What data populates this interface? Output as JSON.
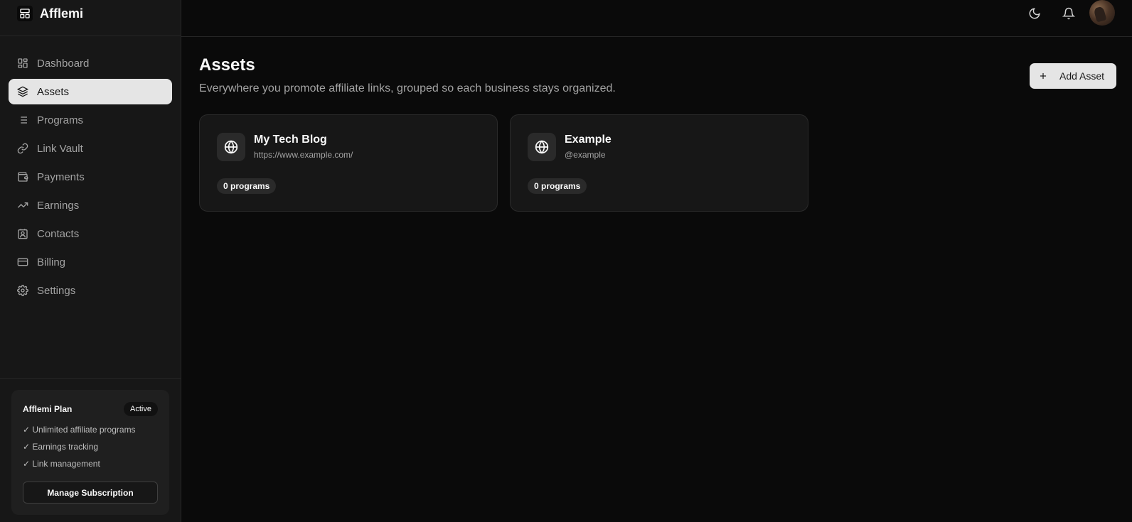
{
  "app": {
    "name": "Afflemi"
  },
  "sidebar": {
    "items": [
      {
        "label": "Dashboard",
        "icon": "dashboard-icon"
      },
      {
        "label": "Assets",
        "icon": "layers-icon",
        "active": true
      },
      {
        "label": "Programs",
        "icon": "list-icon"
      },
      {
        "label": "Link Vault",
        "icon": "link-icon"
      },
      {
        "label": "Payments",
        "icon": "wallet-icon"
      },
      {
        "label": "Earnings",
        "icon": "trending-up-icon"
      },
      {
        "label": "Contacts",
        "icon": "contact-icon"
      },
      {
        "label": "Billing",
        "icon": "credit-card-icon"
      },
      {
        "label": "Settings",
        "icon": "gear-icon"
      }
    ],
    "plan": {
      "title": "Afflemi Plan",
      "status": "Active",
      "features": [
        "✓ Unlimited affiliate programs",
        "✓ Earnings tracking",
        "✓ Link management"
      ],
      "button": "Manage Subscription"
    }
  },
  "topbar": {
    "icons": [
      "moon-icon",
      "bell-icon",
      "avatar"
    ]
  },
  "main": {
    "title": "Assets",
    "subtitle": "Everywhere you promote affiliate links, grouped so each business stays organized.",
    "add_button": "Add Asset",
    "cards": [
      {
        "title": "My Tech Blog",
        "subtitle": "https://www.example.com/",
        "badge": "0 programs",
        "icon": "globe-icon"
      },
      {
        "title": "Example",
        "subtitle": "@example",
        "badge": "0 programs",
        "icon": "globe-icon"
      }
    ]
  },
  "colors": {
    "background": "#0a0a0a",
    "sidebar": "#171717",
    "active_item": "#e5e5e5",
    "muted_text": "#a3a3a3"
  }
}
